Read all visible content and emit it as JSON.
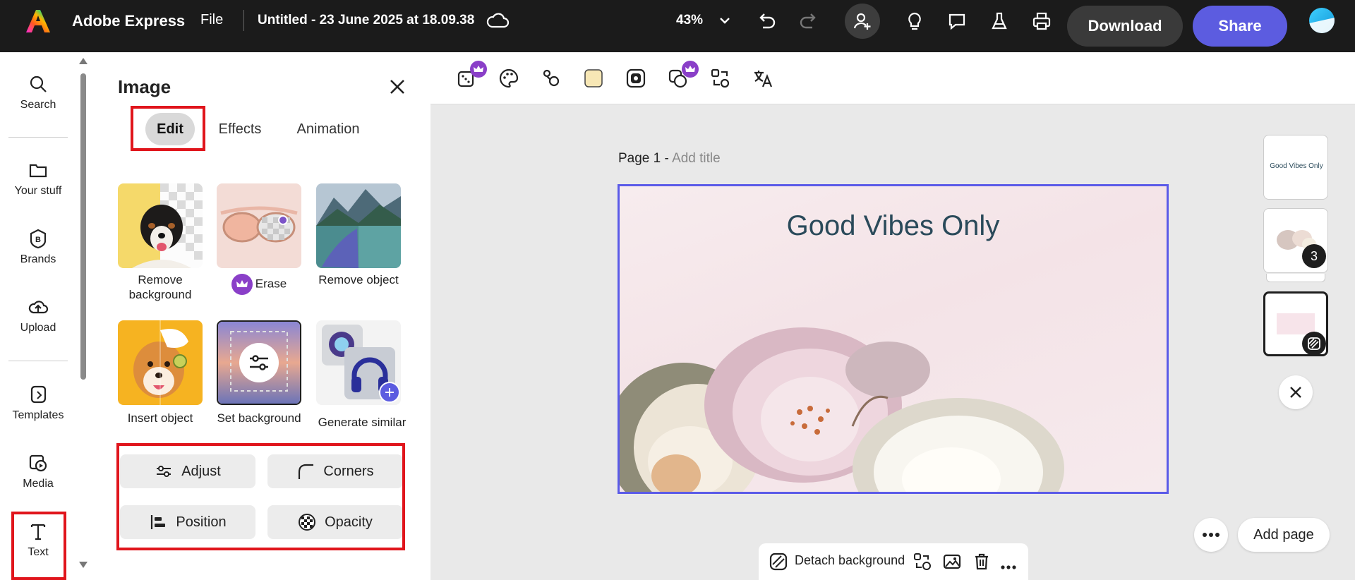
{
  "header": {
    "app_name": "Adobe Express",
    "file_menu": "File",
    "doc_title": "Untitled - 23 June 2025 at 18.09.38",
    "zoom": "43%",
    "download_label": "Download",
    "share_label": "Share"
  },
  "rail": {
    "items": [
      {
        "label": "Search",
        "icon": "search-icon"
      },
      {
        "label": "Your stuff",
        "icon": "folder-icon"
      },
      {
        "label": "Brands",
        "icon": "brand-icon"
      },
      {
        "label": "Upload",
        "icon": "upload-icon"
      },
      {
        "label": "Templates",
        "icon": "templates-icon"
      },
      {
        "label": "Media",
        "icon": "media-icon"
      },
      {
        "label": "Text",
        "icon": "text-icon"
      }
    ]
  },
  "panel": {
    "title": "Image",
    "tabs": [
      "Edit",
      "Effects",
      "Animation"
    ],
    "active_tab": "Edit",
    "tiles": [
      {
        "label": "Remove background"
      },
      {
        "label": "Erase",
        "premium": true
      },
      {
        "label": "Remove object"
      },
      {
        "label": "Insert object"
      },
      {
        "label": "Set background"
      },
      {
        "label": "Generate similar"
      }
    ],
    "buttons": {
      "adjust": "Adjust",
      "corners": "Corners",
      "position": "Position",
      "opacity": "Opacity"
    }
  },
  "canvas": {
    "page_label": "Page 1 -",
    "add_title": "Add title",
    "artboard_text": "Good Vibes Only",
    "thumb1_text": "Good Vibes Only",
    "thumb2_badge": "3",
    "add_page": "Add page",
    "bottom_bar": {
      "detach_label": "Detach background"
    }
  },
  "colors": {
    "accent": "#5c5ce0",
    "highlight": "#e0151c",
    "premium": "#8a3fc8"
  }
}
